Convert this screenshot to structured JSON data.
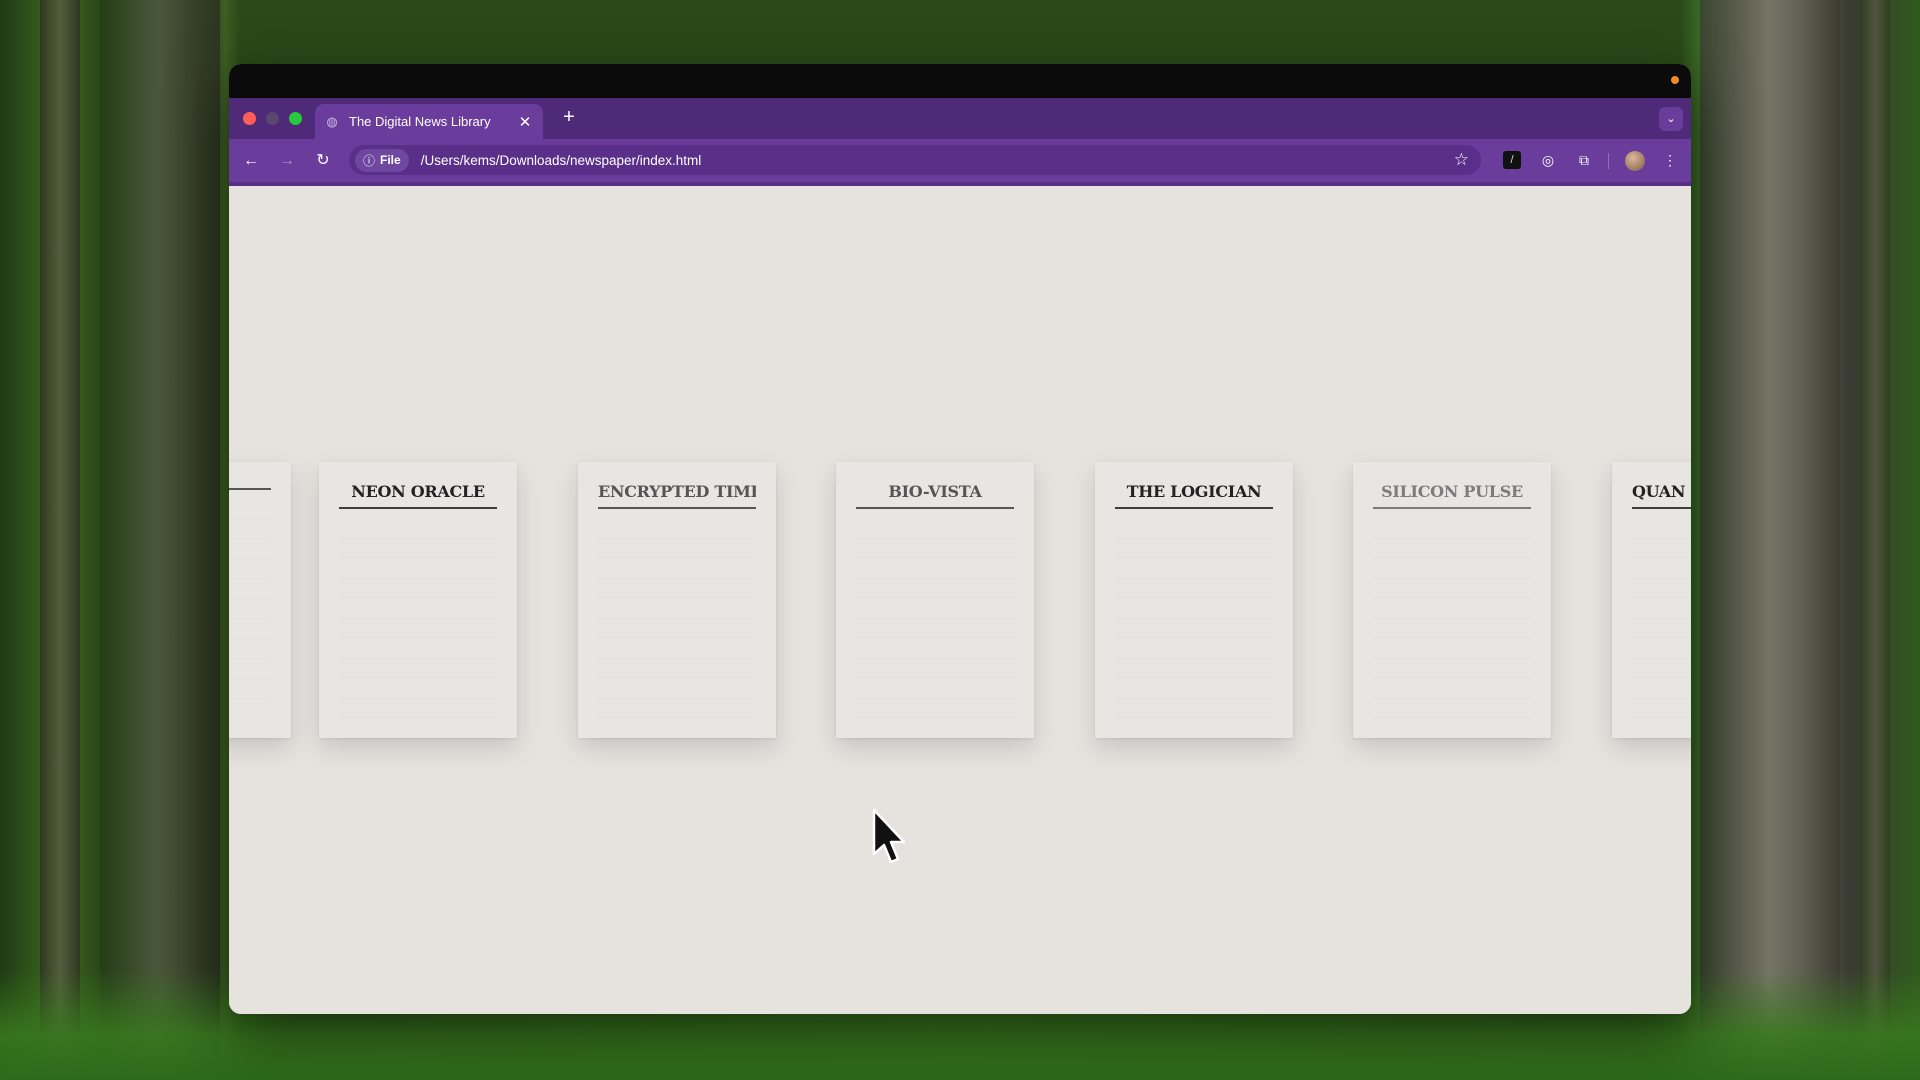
{
  "browser": {
    "tab": {
      "title": "The Digital News Library"
    },
    "new_tab_label": "+",
    "address": {
      "scheme_chip": "File",
      "url": "/Users/kems/Downloads/newspaper/index.html"
    },
    "theme_color": "#6a3c9c"
  },
  "library": {
    "cards": [
      {
        "title": ""
      },
      {
        "title": "NEON ORACLE"
      },
      {
        "title": "ENCRYPTED TIMES"
      },
      {
        "title": "BIO-VISTA"
      },
      {
        "title": "THE LOGICIAN"
      },
      {
        "title": "SILICON PULSE"
      },
      {
        "title": "QUAN"
      }
    ]
  }
}
